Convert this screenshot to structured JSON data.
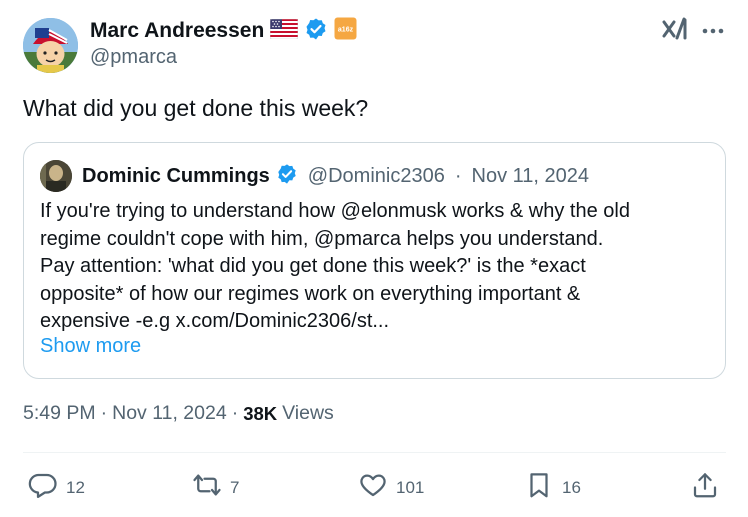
{
  "author": {
    "name": "Marc Andreessen",
    "handle": "@pmarca",
    "badge_text": "a16z"
  },
  "tweet": {
    "text": "What did you get done this week?",
    "time": "5:49 PM",
    "date": "Nov 11, 2024",
    "sep": "·",
    "views_count": "38K",
    "views_label": "Views"
  },
  "quote": {
    "name": "Dominic Cummings",
    "handle": "@Dominic2306",
    "sep": "·",
    "date": "Nov 11, 2024",
    "lines": [
      "If you're trying to understand how @elonmusk works & why the old",
      "regime couldn't cope with him, @pmarca helps you understand.",
      "Pay attention: 'what did you get done this week?' is the *exact",
      "opposite* of how our regimes work on everything important &",
      "expensive -e.g x.com/Dominic2306/st..."
    ],
    "show_more": "Show more"
  },
  "actions": {
    "replies": "12",
    "reposts": "7",
    "likes": "101",
    "bookmarks": "16"
  },
  "colors": {
    "verified": "#1d9bf0",
    "link": "#1d9bf0",
    "muted": "#536471",
    "text": "#0f1419",
    "border": "#cfd9de",
    "badge": "#f5a742"
  },
  "icons": [
    "us-flag-icon",
    "verified-icon",
    "a16z-badge-icon",
    "xai-icon",
    "more-icon",
    "reply-icon",
    "repost-icon",
    "like-icon",
    "bookmark-icon",
    "share-icon"
  ]
}
